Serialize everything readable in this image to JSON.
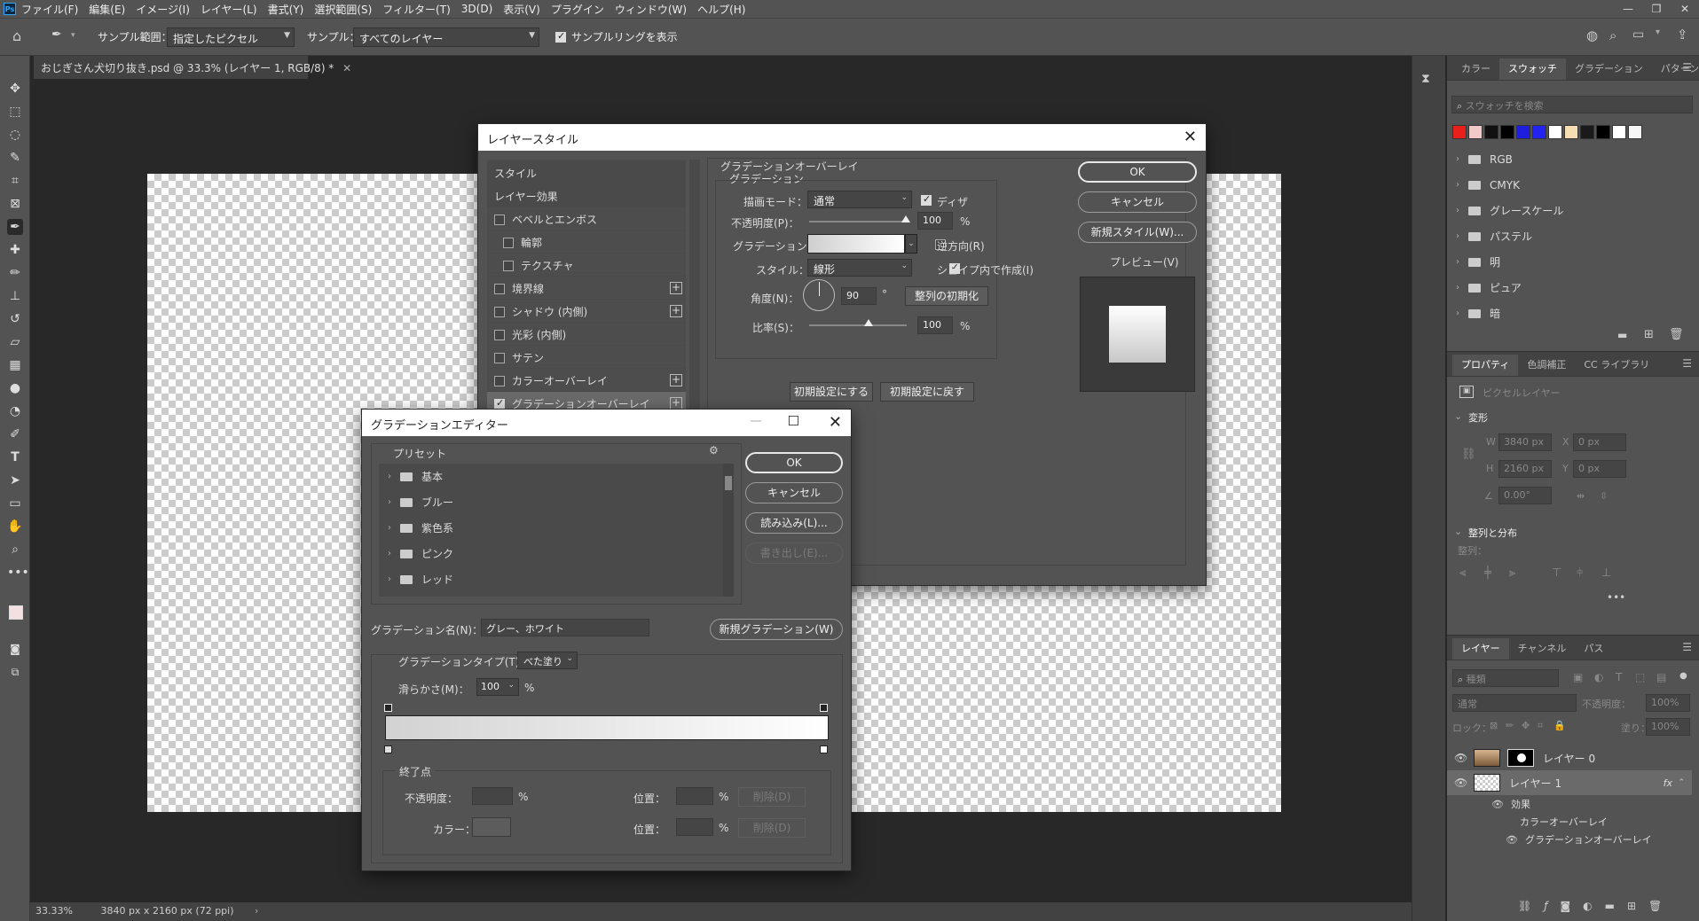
{
  "app": {
    "logo": "Ps"
  },
  "menu": [
    "ファイル(F)",
    "編集(E)",
    "イメージ(I)",
    "レイヤー(L)",
    "書式(Y)",
    "選択範囲(S)",
    "フィルター(T)",
    "3D(D)",
    "表示(V)",
    "プラグイン",
    "ウィンドウ(W)",
    "ヘルプ(H)"
  ],
  "options_bar": {
    "sample_range_label": "サンプル範囲：",
    "sample_range_value": "指定したピクセル",
    "sample_label": "サンプル：",
    "sample_value": "すべてのレイヤー",
    "show_ring_label": "サンプルリングを表示"
  },
  "document": {
    "tab_title": "おじぎさん犬切り抜き.psd @ 33.3% (レイヤー 1, RGB/8) *",
    "zoom": "33.33%",
    "dimensions": "3840 px x 2160 px (72 ppi)"
  },
  "swatches_panel": {
    "tabs": [
      "カラー",
      "スウォッチ",
      "グラデーション",
      "パターン"
    ],
    "search_placeholder": "スウォッチを検索",
    "colors": [
      "#e8201c",
      "#f2c9c9",
      "#111111",
      "#000000",
      "#1e1edc",
      "#2323f0",
      "#ffffff",
      "#f5deb3",
      "#1a1a1a",
      "#000000",
      "#ffffff",
      "#f5f5f5"
    ],
    "folders": [
      "RGB",
      "CMYK",
      "グレースケール",
      "パステル",
      "明",
      "ピュア",
      "暗"
    ]
  },
  "properties_panel": {
    "tabs": [
      "プロパティ",
      "色調補正",
      "CC ライブラリ"
    ],
    "type": "ピクセルレイヤー",
    "transform_header": "変形",
    "w_label": "W",
    "w_value": "3840 px",
    "x_label": "X",
    "x_value": "0 px",
    "h_label": "H",
    "h_value": "2160 px",
    "y_label": "Y",
    "y_value": "0 px",
    "angle_value": "0.00°",
    "align_header": "整列と分布",
    "align_label": "整列："
  },
  "layers_panel": {
    "tabs": [
      "レイヤー",
      "チャンネル",
      "パス"
    ],
    "filter_placeholder": "種類",
    "blend_mode": "通常",
    "opacity_label": "不透明度：",
    "opacity_value": "100%",
    "lock_label": "ロック：",
    "fill_label": "塗り：",
    "fill_value": "100%",
    "layers": [
      {
        "name": "レイヤー 0"
      },
      {
        "name": "レイヤー 1",
        "fx": "fx"
      }
    ],
    "effects_label": "効果",
    "effects": [
      "カラーオーバーレイ",
      "グラデーションオーバーレイ"
    ]
  },
  "layer_style": {
    "title": "レイヤースタイル",
    "list": [
      {
        "label": "スタイル",
        "header": true
      },
      {
        "label": "レイヤー効果",
        "header": true
      },
      {
        "label": "ベベルとエンボス"
      },
      {
        "label": "輪郭",
        "indent": true
      },
      {
        "label": "テクスチャ",
        "indent": true
      },
      {
        "label": "境界線",
        "plus": true
      },
      {
        "label": "シャドウ (内側)",
        "plus": true
      },
      {
        "label": "光彩 (内側)"
      },
      {
        "label": "サテン"
      },
      {
        "label": "カラーオーバーレイ",
        "plus": true
      },
      {
        "label": "グラデーションオーバーレイ",
        "plus": true,
        "checked": true
      }
    ],
    "section_title": "グラデーションオーバーレイ",
    "group_title": "グラデーション",
    "blend_label": "描画モード：",
    "blend_value": "通常",
    "dither_label": "ディザ",
    "opacity_label": "不透明度(P)：",
    "opacity_value": "100",
    "percent": "%",
    "gradient_label": "グラデーション：",
    "reverse_label": "逆方向(R)",
    "style_label": "スタイル：",
    "style_value": "線形",
    "align_shape_label": "シェイプ内で作成(I)",
    "angle_label": "角度(N)：",
    "angle_value": "90",
    "degree": "°",
    "reset_align": "整列の初期化",
    "scale_label": "比率(S)：",
    "scale_value": "100",
    "make_default": "初期設定にする",
    "reset_default": "初期設定に戻す",
    "ok": "OK",
    "cancel": "キャンセル",
    "new_style": "新規スタイル(W)...",
    "preview_label": "プレビュー(V)"
  },
  "gradient_editor": {
    "title": "グラデーションエディター",
    "preset_label": "プリセット",
    "presets": [
      "基本",
      "ブルー",
      "紫色系",
      "ピンク",
      "レッド"
    ],
    "ok": "OK",
    "cancel": "キャンセル",
    "load": "読み込み(L)...",
    "export": "書き出し(E)...",
    "name_label": "グラデーション名(N)：",
    "name_value": "グレー、ホワイト",
    "new_gradient": "新規グラデーション(W)",
    "type_label": "グラデーションタイプ(T)：",
    "type_value": "べた塗り",
    "smooth_label": "滑らかさ(M)：",
    "smooth_value": "100",
    "percent": "%",
    "stops_label": "終了点",
    "opacity_label": "不透明度：",
    "location_label": "位置：",
    "delete_label": "削除(D)",
    "color_label": "カラー："
  }
}
